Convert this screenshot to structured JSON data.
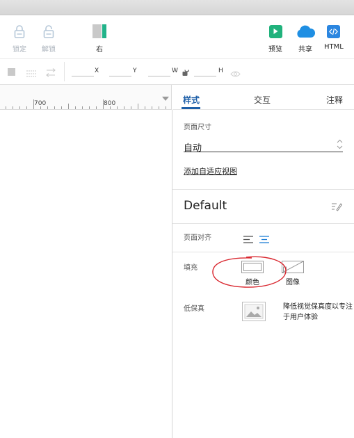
{
  "toolbar": {
    "lock": "锁定",
    "unlock": "解锁",
    "align_right": "右",
    "preview": "预览",
    "share": "共享",
    "html": "HTML"
  },
  "propbar": {
    "x_label": "X",
    "y_label": "Y",
    "w_label": "W",
    "h_label": "H"
  },
  "ruler": {
    "labels": [
      "700",
      "800"
    ]
  },
  "panel": {
    "tabs": [
      "样式",
      "交互",
      "注释"
    ],
    "page_size_title": "页面尺寸",
    "page_size_value": "自动",
    "add_adaptive_view": "添加自适应视图",
    "style_name": "Default",
    "page_align_label": "页面对齐",
    "fill_label": "填充",
    "fill_color": "颜色",
    "fill_image": "图像",
    "lofi_label": "低保真",
    "lofi_desc": "降低视觉保真度以专注于用户体验"
  },
  "colors": {
    "accent_blue": "#1e5fa8",
    "preview_green": "#20b27c",
    "share_blue": "#1f8fe3",
    "html_blue": "#2b86e0",
    "annotation_red": "#d9262e"
  }
}
